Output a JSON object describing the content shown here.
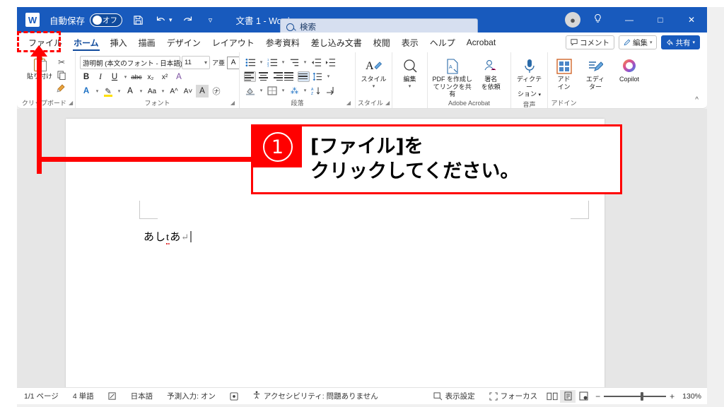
{
  "titlebar": {
    "app_icon": "word-logo-icon",
    "autosave_label": "自動保存",
    "autosave_state": "オフ",
    "save_icon": "save-icon",
    "undo_icon": "undo-icon",
    "redo_icon": "redo-icon",
    "qat_more_icon": "quick-access-more-icon",
    "document_title": "文書 1  -  Word",
    "search_placeholder": "検索",
    "account_icon": "account-avatar-icon",
    "lightbulb_icon": "lightbulb-icon",
    "minimize_label": "—",
    "maximize_label": "□",
    "close_label": "✕"
  },
  "ribbon_tabs": [
    {
      "label": "ファイル",
      "active": false
    },
    {
      "label": "ホーム",
      "active": true
    },
    {
      "label": "挿入",
      "active": false
    },
    {
      "label": "描画",
      "active": false
    },
    {
      "label": "デザイン",
      "active": false
    },
    {
      "label": "レイアウト",
      "active": false
    },
    {
      "label": "参考資料",
      "active": false
    },
    {
      "label": "差し込み文書",
      "active": false
    },
    {
      "label": "校閲",
      "active": false
    },
    {
      "label": "表示",
      "active": false
    },
    {
      "label": "ヘルプ",
      "active": false
    },
    {
      "label": "Acrobat",
      "active": false
    }
  ],
  "tabstrip_right": {
    "comment_label": "コメント",
    "edit_label": "編集",
    "share_label": "共有"
  },
  "ribbon": {
    "clipboard": {
      "group_label": "クリップボード",
      "paste_label": "貼り付け",
      "cut_icon": "scissors-icon",
      "copy_icon": "copy-icon",
      "format_painter_icon": "format-painter-icon"
    },
    "font": {
      "group_label": "フォント",
      "font_name": "游明朝 (本文のフォント - 日本語)",
      "font_size": "11",
      "phonetic_guide_icon": "phonetic-guide-icon",
      "char_border_icon": "character-border-icon",
      "bold_label": "B",
      "italic_label": "I",
      "underline_label": "U",
      "strikethrough_label": "abc",
      "subscript_label": "x₂",
      "superscript_label": "x²",
      "clear_format_icon": "clear-formatting-icon",
      "text_effects_label": "A",
      "highlight_label": "✐",
      "font_color_label": "A",
      "change_case_label": "Aa",
      "grow_font_label": "A^",
      "shrink_font_label": "A˅",
      "char_shading_label": "A",
      "enclose_char_label": "㋤"
    },
    "paragraph": {
      "group_label": "段落",
      "bullets_icon": "bullet-list-icon",
      "numbering_icon": "numbered-list-icon",
      "multilevel_icon": "multilevel-list-icon",
      "decrease_indent_icon": "decrease-indent-icon",
      "increase_indent_icon": "increase-indent-icon",
      "align_left_icon": "align-left-icon",
      "align_center_icon": "align-center-icon",
      "align_right_icon": "align-right-icon",
      "justify_icon": "justify-icon",
      "distribute_icon": "distribute-icon",
      "line_spacing_icon": "line-spacing-icon",
      "shading_icon": "shading-icon",
      "borders_icon": "borders-icon",
      "show_marks_icon": "show-formatting-marks-icon",
      "sort_icon": "sort-icon"
    },
    "styles": {
      "group_label": "スタイル",
      "button_label": "スタイル"
    },
    "editing": {
      "group_label": "",
      "button_label": "編集"
    },
    "acrobat": {
      "group_label": "Adobe Acrobat",
      "create_pdf_label": "PDF を作成し\nてリンクを共有",
      "request_sign_label": "署名\nを依頼"
    },
    "voice": {
      "group_label": "音声",
      "dictate_label": "ディクテー\nション"
    },
    "addins": {
      "group_label": "アドイン",
      "addins_label": "アド\nイン"
    },
    "editor_label": "エディ\nター",
    "copilot_label": "Copilot",
    "collapse_icon": "collapse-ribbon-icon"
  },
  "document": {
    "body_text_a": "あし",
    "body_text_misspelled": "t",
    "body_text_b": "あ",
    "paragraph_mark": "↵"
  },
  "annotation": {
    "step_number": "①",
    "line1": "[ファイル]を",
    "line2": "クリックしてください。",
    "color": "#FF0000"
  },
  "statusbar": {
    "page": "1/1 ページ",
    "words": "4 単語",
    "proofing_icon": "proofing-errors-icon",
    "language": "日本語",
    "prediction": "予測入力: オン",
    "prediction_icon": "text-prediction-icon",
    "accessibility_icon": "accessibility-icon",
    "accessibility": "アクセシビリティ: 問題ありません",
    "display_settings": "表示設定",
    "focus": "フォーカス",
    "read_mode_icon": "read-mode-icon",
    "print_layout_icon": "print-layout-icon",
    "web_layout_icon": "web-layout-icon",
    "zoom_out": "−",
    "zoom_in": "+",
    "zoom_level": "130%"
  }
}
